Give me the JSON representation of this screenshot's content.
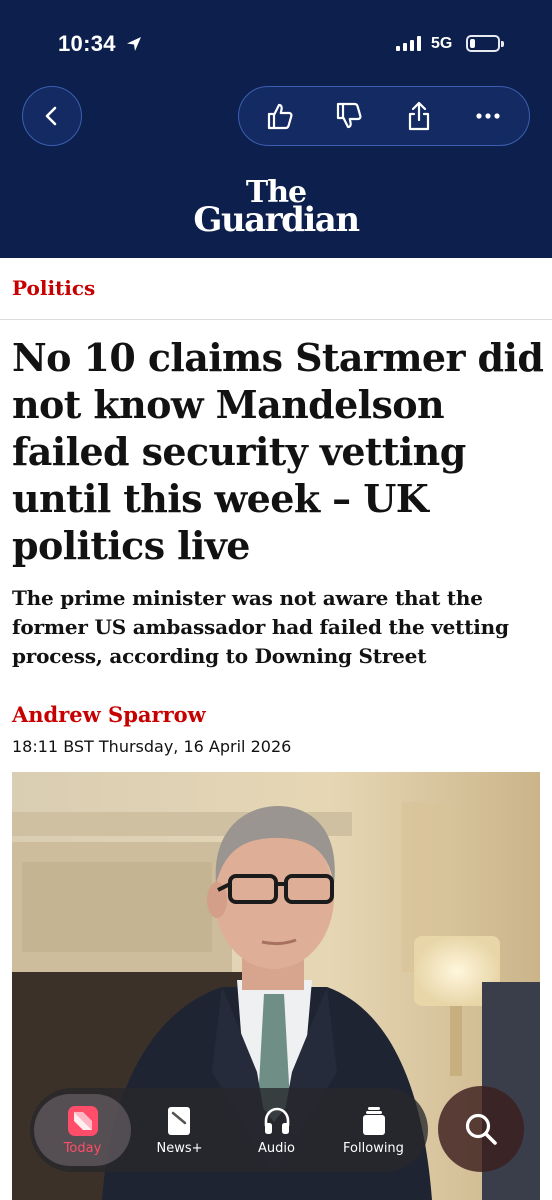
{
  "status_bar": {
    "time": "10:34",
    "network": "5G",
    "signal_bars": 4,
    "battery_level": 0.15
  },
  "nav": {
    "back_icon": "chevron-left-icon",
    "actions": [
      "thumbs-up-icon",
      "thumbs-down-icon",
      "share-icon",
      "more-icon"
    ]
  },
  "masthead": {
    "line1": "The",
    "line2": "Guardian"
  },
  "article": {
    "section": "Politics",
    "headline": "No 10 claims Starmer did not know Mandelson failed security vetting until this week – UK politics live",
    "standfirst": "The prime minister was not aware that the former US ambassador had failed the vetting process, according to Downing Street",
    "author": "Andrew Sparrow",
    "dateline": "18:11 BST Thursday, 16 April 2026"
  },
  "tabbar": {
    "tabs": [
      {
        "label": "Today",
        "icon": "news-logo-icon",
        "active": true
      },
      {
        "label": "News+",
        "icon": "news-plus-icon",
        "active": false
      },
      {
        "label": "Audio",
        "icon": "headphones-icon",
        "active": false
      },
      {
        "label": "Following",
        "icon": "following-icon",
        "active": false
      }
    ],
    "search_icon": "search-icon"
  },
  "colors": {
    "header_bg": "#0c1f4d",
    "accent_red": "#c70000",
    "active_tab": "#ff4d6a"
  }
}
